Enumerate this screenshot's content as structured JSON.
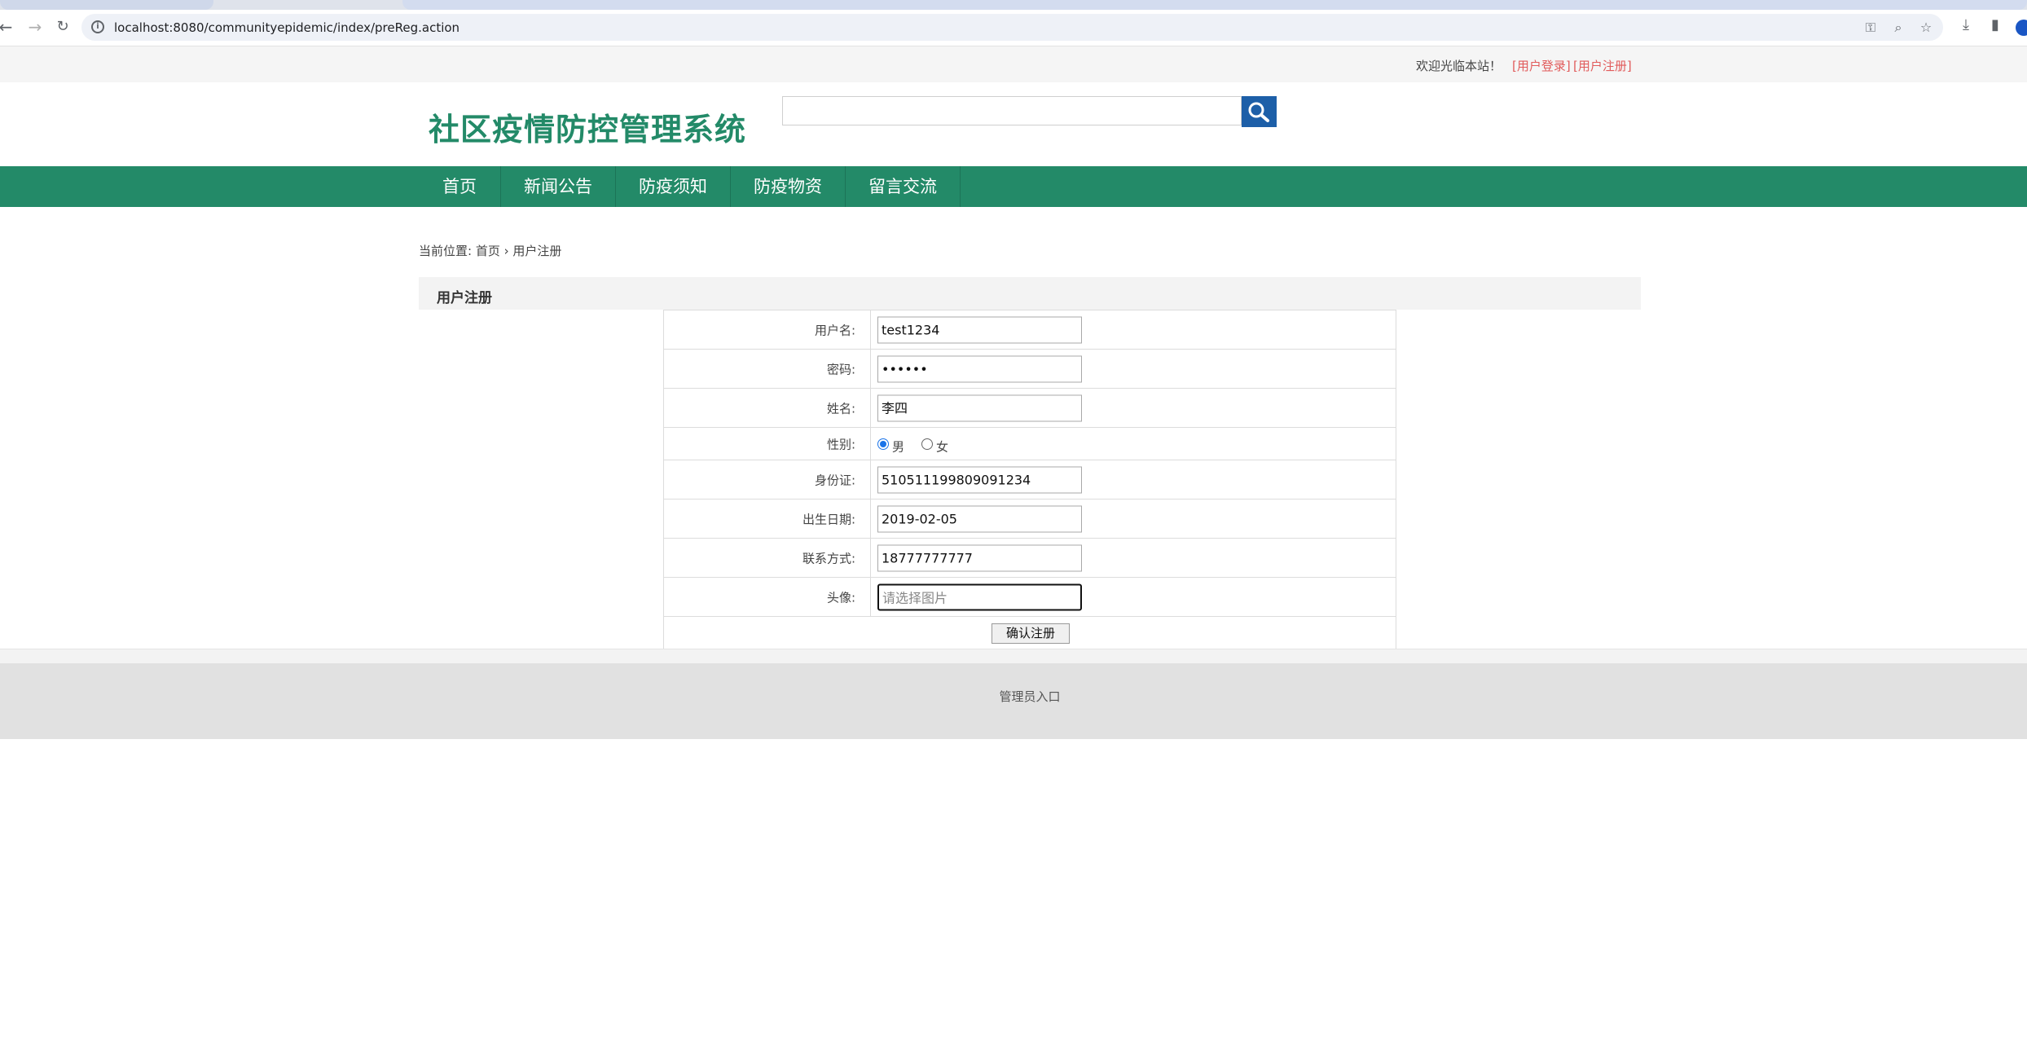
{
  "browser": {
    "url": "localhost:8080/communityepidemic/index/preReg.action"
  },
  "topbar": {
    "welcome": "欢迎光临本站！",
    "login_link": "[用户登录]",
    "register_link": "[用户注册]"
  },
  "header": {
    "site_title": "社区疫情防控管理系统",
    "search_value": ""
  },
  "nav": {
    "items": [
      "首页",
      "新闻公告",
      "防疫须知",
      "防疫物资",
      "留言交流"
    ]
  },
  "breadcrumb": {
    "prefix": "当前位置:",
    "home": "首页",
    "separator": "›",
    "current": "用户注册"
  },
  "section": {
    "title": "用户注册"
  },
  "form": {
    "username_label": "用户名:",
    "username_value": "test1234",
    "password_label": "密码:",
    "password_value": "••••••",
    "name_label": "姓名:",
    "name_value": "李四",
    "gender_label": "性别:",
    "gender_male": "男",
    "gender_female": "女",
    "gender_selected": "男",
    "id_label": "身份证:",
    "id_value": "510511199809091234",
    "birth_label": "出生日期:",
    "birth_value": "2019-02-05",
    "phone_label": "联系方式:",
    "phone_value": "18777777777",
    "avatar_label": "头像:",
    "avatar_placeholder": "请选择图片",
    "submit_label": "确认注册"
  },
  "footer": {
    "admin_link": "管理员入口"
  },
  "colors": {
    "brand_green": "#238a68",
    "search_blue": "#1d5fa8",
    "link_red": "#e15b5b"
  }
}
